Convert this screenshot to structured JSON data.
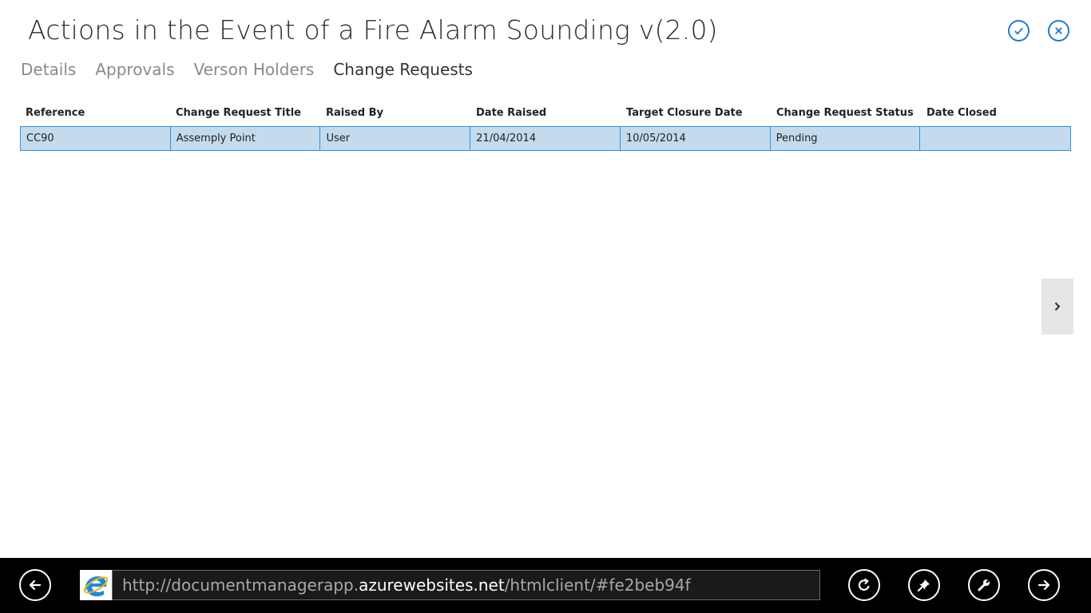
{
  "page": {
    "title": "Actions in the Event of a Fire Alarm Sounding v(2.0)"
  },
  "tabs": [
    {
      "label": "Details",
      "active": false
    },
    {
      "label": "Approvals",
      "active": false
    },
    {
      "label": "Verson Holders",
      "active": false
    },
    {
      "label": "Change Requests",
      "active": true
    }
  ],
  "table": {
    "columns": [
      "Reference",
      "Change Request Title",
      "Raised By",
      "Date Raised",
      "Target Closure Date",
      "Change Request Status",
      "Date Closed"
    ],
    "rows": [
      [
        "CC90",
        "Assemply Point",
        "User",
        "21/04/2014",
        "10/05/2014",
        "Pending",
        ""
      ]
    ]
  },
  "address_bar": {
    "url_prefix": "http://documentmanagerapp.",
    "url_domain": "azurewebsites.net",
    "url_suffix": "/htmlclient/#fe2beb94f"
  },
  "icons": {
    "save": "checkmark-icon",
    "close": "close-icon",
    "next": "chevron-right-icon",
    "back": "back-arrow-icon",
    "browser": "internet-explorer-icon",
    "refresh": "refresh-icon",
    "pin": "pin-icon",
    "tools": "wrench-icon",
    "forward": "forward-arrow-icon"
  },
  "colors": {
    "accent": "#1e7ad6",
    "row_selected_bg": "#c4dbed",
    "row_border": "#2a93e6",
    "appbar_bg": "#000000"
  }
}
